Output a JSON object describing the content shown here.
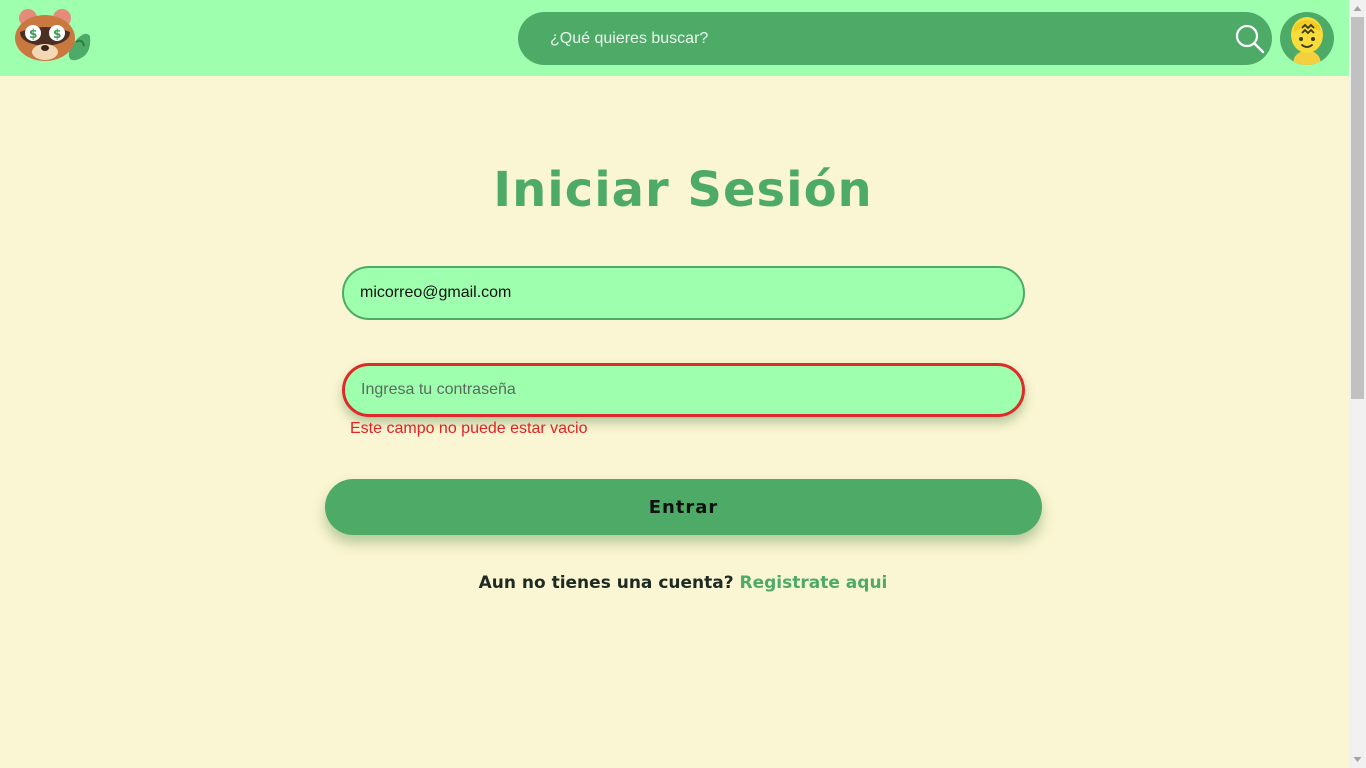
{
  "header": {
    "search": {
      "placeholder": "¿Qué quieres buscar?"
    }
  },
  "login": {
    "title": "Iniciar Sesión",
    "email_value": "micorreo@gmail.com",
    "password_placeholder": "Ingresa tu contraseña",
    "password_error": "Este campo no puede estar vacio",
    "submit_label": "Entrar",
    "register_prompt": "Aun no tienes una cuenta?",
    "register_link": "Registrate aqui"
  },
  "colors": {
    "header_bg": "#9effae",
    "primary_green": "#4eab67",
    "page_bg": "#faf5d2",
    "error_red": "#e02a2a"
  },
  "icons": {
    "logo": "raccoon-logo-icon",
    "search": "search-icon",
    "avatar": "villager-avatar-icon"
  }
}
